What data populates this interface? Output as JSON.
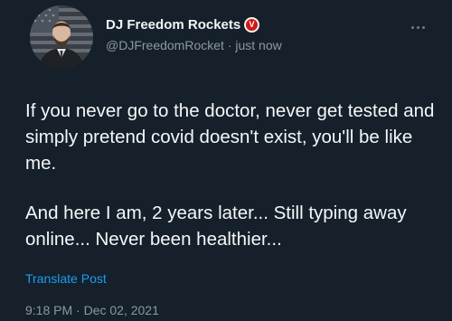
{
  "author": {
    "display_name": "DJ Freedom Rockets",
    "verified_badge_letter": "V",
    "handle": "@DJFreedomRocket",
    "separator": "·",
    "relative_time": "just now"
  },
  "post": {
    "paragraphs": [
      "If you never go to the doctor, never get tested and simply pretend covid doesn't exist, you'll be like me.",
      "And here I am, 2 years later... Still typing away online... Never been healthier..."
    ],
    "translate_label": "Translate Post",
    "timestamp": "9:18 PM · Dec 02, 2021"
  },
  "colors": {
    "background": "#15202b",
    "text": "#e7e9ea",
    "secondary_text": "#8b98a5",
    "link": "#1d9bf0",
    "badge": "#d01818"
  },
  "icons": {
    "more": "more-horizontal-icon",
    "verified": "verified-badge-icon"
  }
}
